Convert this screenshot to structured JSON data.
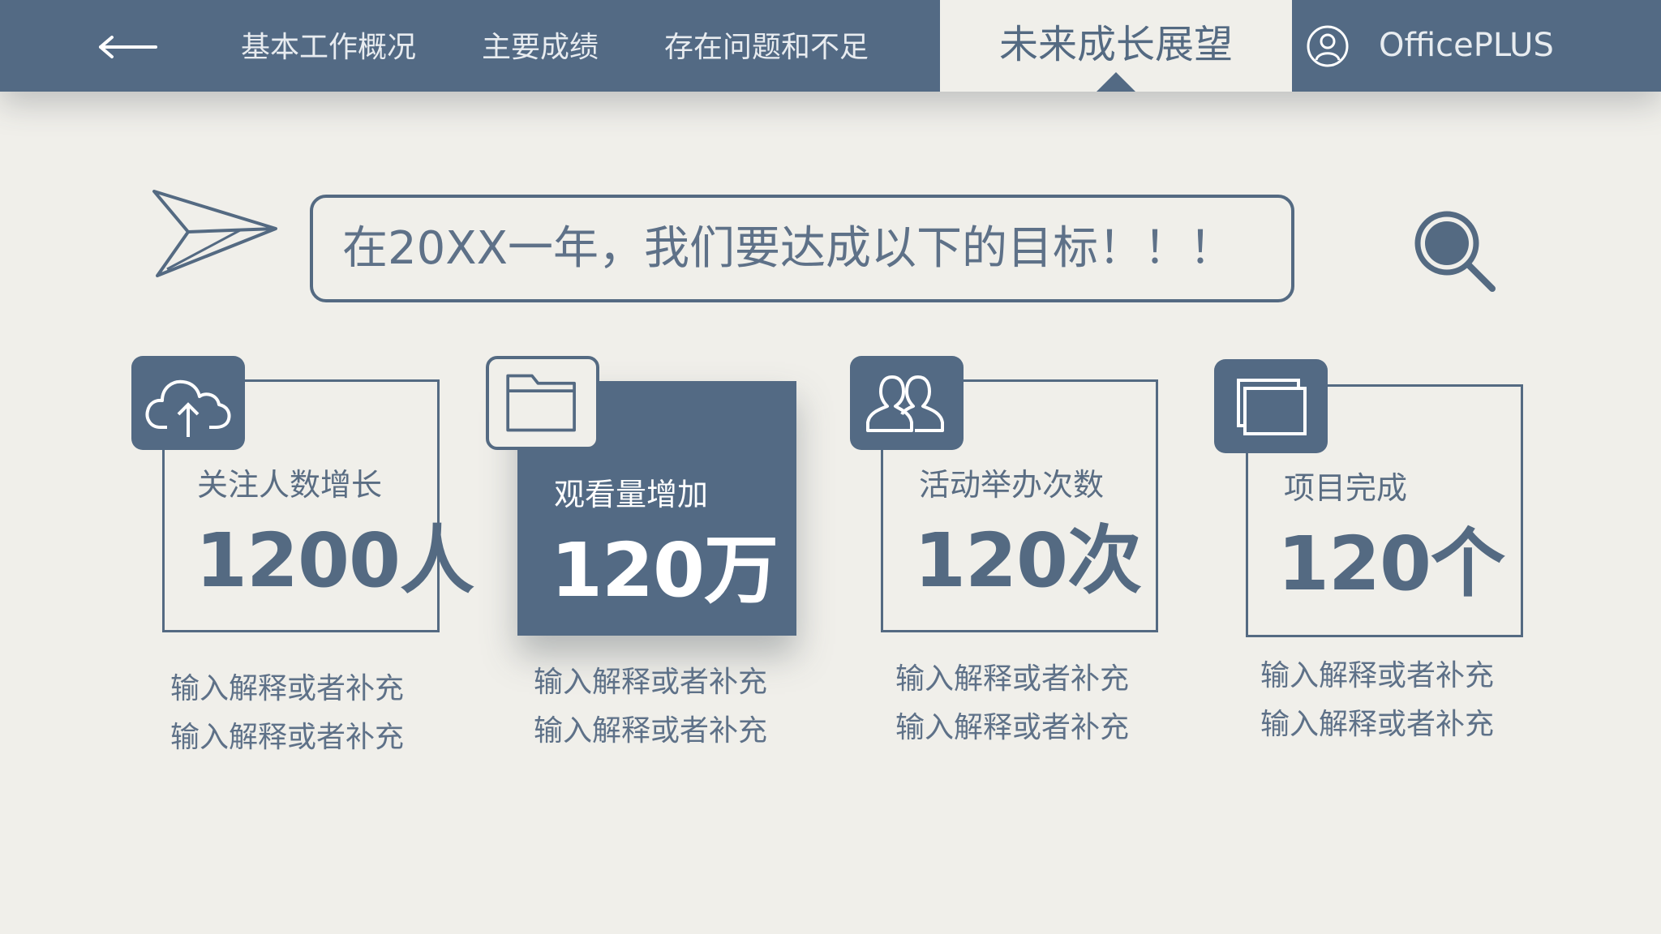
{
  "nav": {
    "tabs": [
      {
        "label": "基本工作概况"
      },
      {
        "label": "主要成绩"
      },
      {
        "label": "存在问题和不足"
      },
      {
        "label": "未来成长展望"
      }
    ],
    "brand": "OfficePLUS"
  },
  "goal": {
    "text": "在20XX一年，我们要达成以下的目标！！！"
  },
  "cards": [
    {
      "icon": "cloud-upload-icon",
      "label": "关注人数增长",
      "value": "1200人",
      "desc": [
        "输入解释或者补充",
        "输入解释或者补充"
      ]
    },
    {
      "icon": "folder-icon",
      "label": "观看量增加",
      "value": "120万",
      "desc": [
        "输入解释或者补充",
        "输入解释或者补充"
      ]
    },
    {
      "icon": "users-icon",
      "label": "活动举办次数",
      "value": "120次",
      "desc": [
        "输入解释或者补充",
        "输入解释或者补充"
      ]
    },
    {
      "icon": "windows-icon",
      "label": "项目完成",
      "value": "120个",
      "desc": [
        "输入解释或者补充",
        "输入解释或者补充"
      ]
    }
  ],
  "colors": {
    "primary": "#536a84",
    "background": "#f0efea",
    "text": "#546a82"
  }
}
